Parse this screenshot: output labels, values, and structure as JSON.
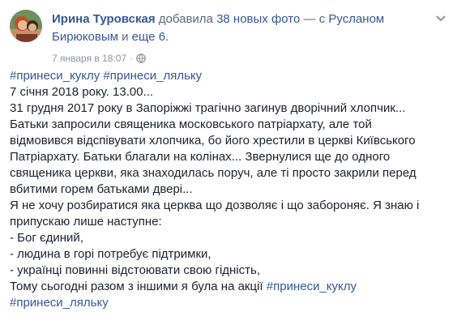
{
  "post": {
    "author": "Ирина Туровская",
    "action_text": " добавила ",
    "photos_link": "38 новых фото",
    "with_text": " — с ",
    "tagged_person": "Русланом Бирюковым",
    "and_text": " и ",
    "others_link": "еще 6",
    "period": ".",
    "timestamp": "7 января в 18:07",
    "separator": "·",
    "privacy_icon": "globe-icon",
    "menu_icon": "chevron-down-icon"
  },
  "content": {
    "hashtags_top": [
      "#принеси_куклу",
      "#принеси_ляльку"
    ],
    "lines": [
      "7 січня 2018 року. 13.00...",
      "31 грудня 2017 року в Запоріжжі трагічно загинув дворічний хлопчик...",
      "Батьки запросили священика московського патріархату, але той",
      "відмовився відспівувати хлопчика, бо його хрестили в церкві Київського",
      "Патріархату. Батьки благали на колінах... Звернулися ще до одного",
      "священика церкви, яка знаходилась поруч, але ті просто закрили перед",
      "вбитими горем батьками двері...",
      "Я не хочу розбиратися яка церква що дозволяє і що забороняє. Я знаю і",
      "припускаю лише наступне:",
      "- Бог єдиний,",
      "- людина в горі потребує підтримки,",
      "- українці повинні відстоювати свою гідність,"
    ],
    "last_line_prefix": "Тому сьогодні разом з іншими я була на акції ",
    "last_line_hashtag": "#принеси_куклу",
    "final_hashtag": "#принеси_ляльку"
  }
}
